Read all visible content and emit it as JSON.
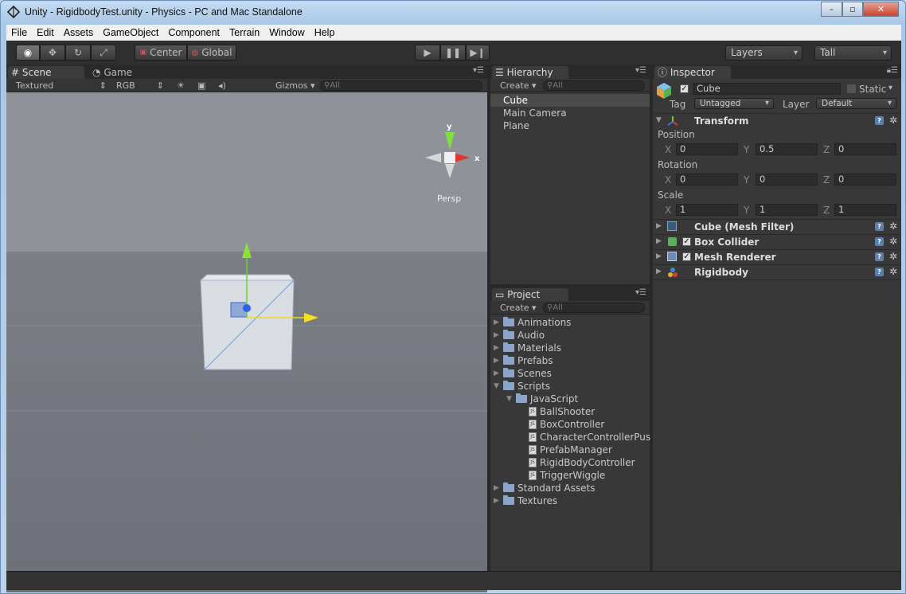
{
  "window": {
    "title": "Unity - RigidbodyTest.unity - Physics - PC and Mac Standalone"
  },
  "menu": [
    "File",
    "Edit",
    "Assets",
    "GameObject",
    "Component",
    "Terrain",
    "Window",
    "Help"
  ],
  "toolbar": {
    "pivot_label": "Center",
    "space_label": "Global",
    "layers_label": "Layers",
    "layout_label": "Tall"
  },
  "scene": {
    "tab_scene": "Scene",
    "tab_game": "Game",
    "render_mode": "Textured",
    "color_mode": "RGB",
    "gizmos_label": "Gizmos",
    "search_placeholder": "All",
    "gizmo_y": "y",
    "gizmo_x": "x",
    "persp_label": "Persp"
  },
  "hierarchy": {
    "tab": "Hierarchy",
    "create_label": "Create",
    "search_placeholder": "All",
    "items": [
      "Cube",
      "Main Camera",
      "Plane"
    ]
  },
  "project": {
    "tab": "Project",
    "create_label": "Create",
    "search_placeholder": "All",
    "rows": [
      {
        "label": "Animations",
        "kind": "folder",
        "depth": 0,
        "expanded": false
      },
      {
        "label": "Audio",
        "kind": "folder",
        "depth": 0,
        "expanded": false
      },
      {
        "label": "Materials",
        "kind": "folder",
        "depth": 0,
        "expanded": false
      },
      {
        "label": "Prefabs",
        "kind": "folder",
        "depth": 0,
        "expanded": false
      },
      {
        "label": "Scenes",
        "kind": "folder",
        "depth": 0,
        "expanded": false
      },
      {
        "label": "Scripts",
        "kind": "folder",
        "depth": 0,
        "expanded": true
      },
      {
        "label": "JavaScript",
        "kind": "folder",
        "depth": 1,
        "expanded": true
      },
      {
        "label": "BallShooter",
        "kind": "script",
        "depth": 2
      },
      {
        "label": "BoxController",
        "kind": "script",
        "depth": 2
      },
      {
        "label": "CharacterControllerPus",
        "kind": "script",
        "depth": 2
      },
      {
        "label": "PrefabManager",
        "kind": "script",
        "depth": 2
      },
      {
        "label": "RigidBodyController",
        "kind": "script",
        "depth": 2
      },
      {
        "label": "TriggerWiggle",
        "kind": "script",
        "depth": 2
      },
      {
        "label": "Standard Assets",
        "kind": "folder",
        "depth": 0,
        "expanded": false
      },
      {
        "label": "Textures",
        "kind": "folder",
        "depth": 0,
        "expanded": false
      }
    ]
  },
  "inspector": {
    "tab": "Inspector",
    "object_name": "Cube",
    "static_label": "Static",
    "tag_label": "Tag",
    "tag_value": "Untagged",
    "layer_label": "Layer",
    "layer_value": "Default",
    "transform": {
      "title": "Transform",
      "position_label": "Position",
      "position": {
        "x": "0",
        "y": "0.5",
        "z": "0"
      },
      "rotation_label": "Rotation",
      "rotation": {
        "x": "0",
        "y": "0",
        "z": "0"
      },
      "scale_label": "Scale",
      "scale": {
        "x": "1",
        "y": "1",
        "z": "1"
      },
      "axis_x": "X",
      "axis_y": "Y",
      "axis_z": "Z"
    },
    "components": [
      {
        "name": "Cube (Mesh Filter)",
        "checkbox": false
      },
      {
        "name": "Box Collider",
        "checkbox": true
      },
      {
        "name": "Mesh Renderer",
        "checkbox": true
      },
      {
        "name": "Rigidbody",
        "checkbox": false
      }
    ]
  }
}
